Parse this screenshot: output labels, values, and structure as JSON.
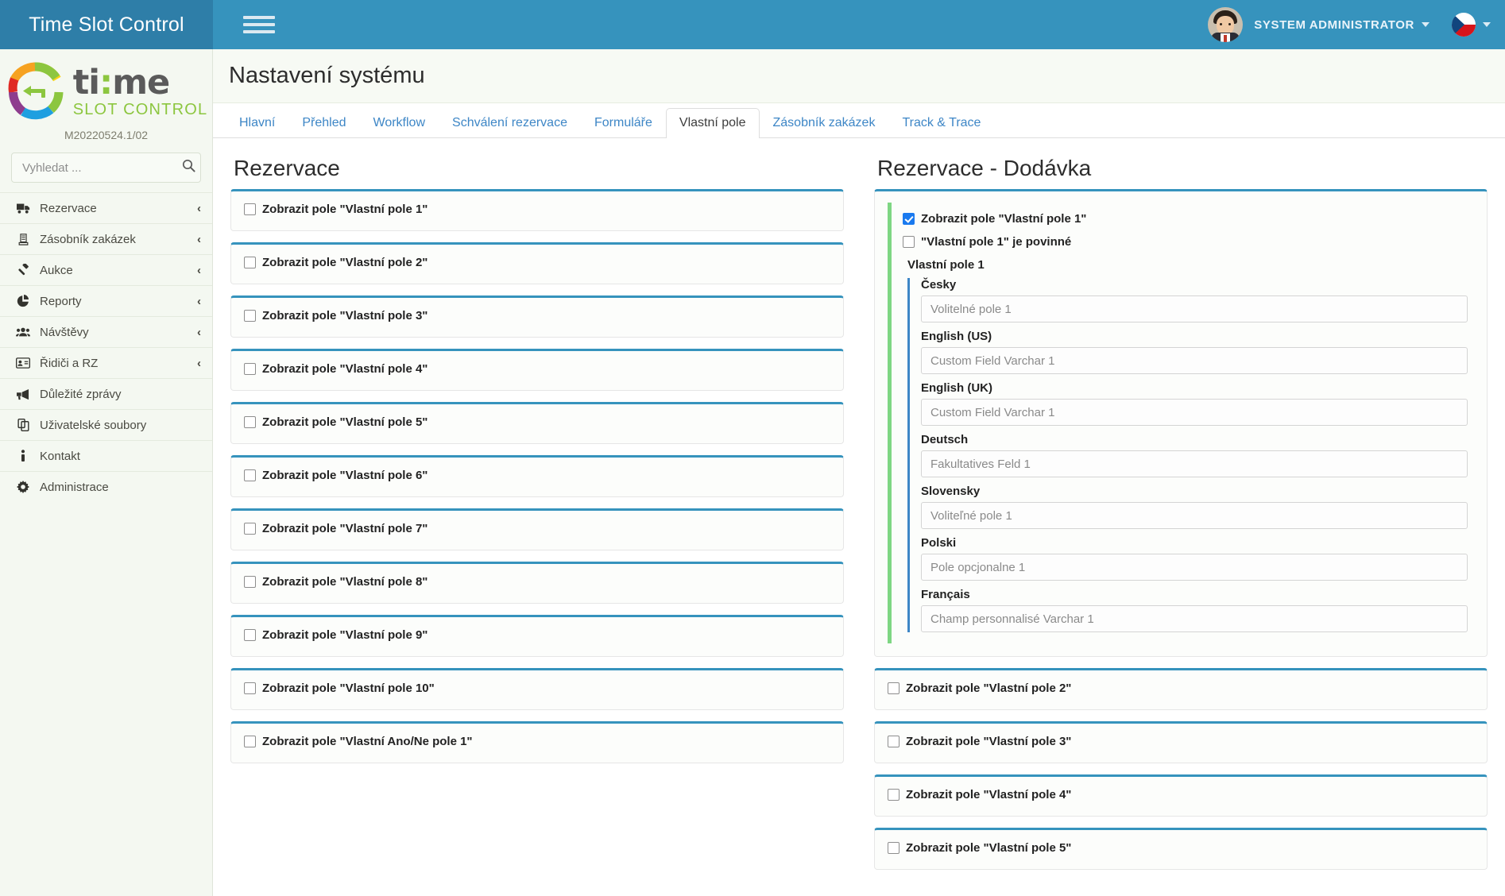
{
  "topbar": {
    "brand_title": "Time Slot Control",
    "menu_icon": "hamburger-icon",
    "username": "SYSTEM ADMINISTRATOR",
    "avatar_icon": "user-avatar",
    "language_flag": "czech-flag-icon"
  },
  "sidebar": {
    "logo_wordmark_1": "ti",
    "logo_colon": ":",
    "logo_wordmark_2": "me",
    "logo_subtitle": "SLOT CONTROL",
    "version": "M20220524.1/02",
    "search": {
      "placeholder": "Vyhledat ...",
      "value": "",
      "icon": "search-icon"
    },
    "items": [
      {
        "label": "Rezervace",
        "icon": "truck-icon",
        "caret": "‹"
      },
      {
        "label": "Zásobník zakázek",
        "icon": "stack-icon",
        "caret": "‹"
      },
      {
        "label": "Aukce",
        "icon": "gavel-icon",
        "caret": "‹"
      },
      {
        "label": "Reporty",
        "icon": "pie-chart-icon",
        "caret": "‹"
      },
      {
        "label": "Návštěvy",
        "icon": "users-icon",
        "caret": "‹"
      },
      {
        "label": "Řidiči a RZ",
        "icon": "id-card-icon",
        "caret": "‹"
      },
      {
        "label": "Důležité zprávy",
        "icon": "megaphone-icon",
        "caret": ""
      },
      {
        "label": "Uživatelské soubory",
        "icon": "copy-files-icon",
        "caret": ""
      },
      {
        "label": "Kontakt",
        "icon": "info-icon",
        "caret": ""
      },
      {
        "label": "Administrace",
        "icon": "gear-icon",
        "caret": ""
      }
    ]
  },
  "page": {
    "title": "Nastavení systému",
    "tabs": [
      {
        "label": "Hlavní",
        "active": false
      },
      {
        "label": "Přehled",
        "active": false
      },
      {
        "label": "Workflow",
        "active": false
      },
      {
        "label": "Schválení rezervace",
        "active": false
      },
      {
        "label": "Formuláře",
        "active": false
      },
      {
        "label": "Vlastní pole",
        "active": true
      },
      {
        "label": "Zásobník zakázek",
        "active": false
      },
      {
        "label": "Track & Trace",
        "active": false
      }
    ]
  },
  "left_column": {
    "title": "Rezervace",
    "cards": [
      {
        "label": "Zobrazit pole \"Vlastní pole 1\"",
        "checked": false
      },
      {
        "label": "Zobrazit pole \"Vlastní pole 2\"",
        "checked": false
      },
      {
        "label": "Zobrazit pole \"Vlastní pole 3\"",
        "checked": false
      },
      {
        "label": "Zobrazit pole \"Vlastní pole 4\"",
        "checked": false
      },
      {
        "label": "Zobrazit pole \"Vlastní pole 5\"",
        "checked": false
      },
      {
        "label": "Zobrazit pole \"Vlastní pole 6\"",
        "checked": false
      },
      {
        "label": "Zobrazit pole \"Vlastní pole 7\"",
        "checked": false
      },
      {
        "label": "Zobrazit pole \"Vlastní pole 8\"",
        "checked": false
      },
      {
        "label": "Zobrazit pole \"Vlastní pole 9\"",
        "checked": false
      },
      {
        "label": "Zobrazit pole \"Vlastní pole 10\"",
        "checked": false
      },
      {
        "label": "Zobrazit pole \"Vlastní Ano/Ne pole 1\"",
        "checked": false
      }
    ]
  },
  "right_column": {
    "title": "Rezervace - Dodávka",
    "expanded_card": {
      "show_label": "Zobrazit pole \"Vlastní pole 1\"",
      "show_checked": true,
      "required_label": "\"Vlastní pole 1\" je povinné",
      "required_checked": false,
      "group_name": "Vlastní pole 1",
      "languages": [
        {
          "label": "Česky",
          "placeholder": "Volitelné pole 1",
          "value": ""
        },
        {
          "label": "English (US)",
          "placeholder": "Custom Field Varchar 1",
          "value": ""
        },
        {
          "label": "English (UK)",
          "placeholder": "Custom Field Varchar 1",
          "value": ""
        },
        {
          "label": "Deutsch",
          "placeholder": "Fakultatives Feld 1",
          "value": ""
        },
        {
          "label": "Slovensky",
          "placeholder": "Voliteľné pole 1",
          "value": ""
        },
        {
          "label": "Polski",
          "placeholder": "Pole opcjonalne 1",
          "value": ""
        },
        {
          "label": "Français",
          "placeholder": "Champ personnalisé Varchar 1",
          "value": ""
        }
      ]
    },
    "cards": [
      {
        "label": "Zobrazit pole \"Vlastní pole 2\"",
        "checked": false
      },
      {
        "label": "Zobrazit pole \"Vlastní pole 3\"",
        "checked": false
      },
      {
        "label": "Zobrazit pole \"Vlastní pole 4\"",
        "checked": false
      },
      {
        "label": "Zobrazit pole \"Vlastní pole 5\"",
        "checked": false
      }
    ]
  },
  "colors": {
    "header": "#3693bd",
    "header_brand": "#2e7ea8",
    "card_top_border": "#3693bd",
    "expanded_border": "#7ed683",
    "lang_border": "#3d86c6",
    "checkbox_checked": "#1a7aef",
    "link": "#3d86c6",
    "logo_green": "#8cc63f",
    "sidebar_bg": "#f4f8f1"
  }
}
